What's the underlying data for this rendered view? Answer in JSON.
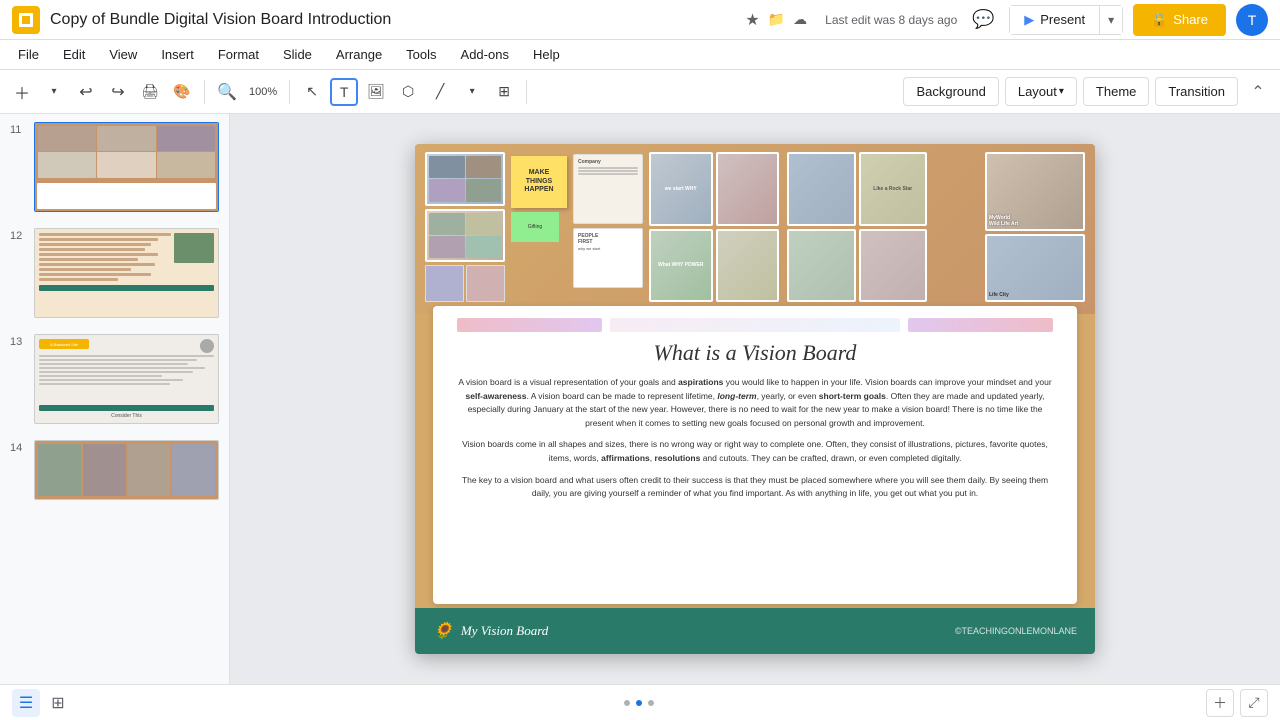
{
  "app": {
    "icon_color": "#F4B400",
    "title": "Copy of Bundle Digital Vision Board Introduction",
    "star_icon": "★",
    "folder_icon": "📁",
    "cloud_icon": "☁",
    "last_edit": "Last edit was 8 days ago"
  },
  "menu": {
    "items": [
      "File",
      "Edit",
      "View",
      "Insert",
      "Format",
      "Slide",
      "Arrange",
      "Tools",
      "Add-ons",
      "Help"
    ]
  },
  "toolbar": {
    "background_label": "Background",
    "layout_label": "Layout",
    "theme_label": "Theme",
    "transition_label": "Transition"
  },
  "header": {
    "present_label": "Present",
    "share_label": "Share",
    "avatar_letter": "T",
    "lock_icon": "🔒"
  },
  "slides": [
    {
      "number": "11",
      "type": "collage"
    },
    {
      "number": "12",
      "type": "text"
    },
    {
      "number": "13",
      "type": "text-badge"
    },
    {
      "number": "14",
      "type": "photos"
    }
  ],
  "main_slide": {
    "heading": "What is a Vision Board",
    "paragraph1": "A vision board is a visual representation of your goals and aspirations you would like to happen in your life. Vision boards can improve your mindset and your self-awareness. A vision board can be made to represent lifetime, long-term, yearly, or even short-term goals. Often they are made and updated yearly, especially during January at the start of the new year. However, there is no need to wait for the new year to make a vision board! There is no time like the present when it comes to setting new goals focused on personal growth and improvement.",
    "paragraph2": "Vision boards come in all shapes and sizes, there is no wrong way or right way to complete one. Often, they consist of illustrations, pictures, favorite quotes, items, words, affirmations, resolutions and cutouts. They can be crafted, drawn, or even completed digitally.",
    "paragraph3": "The key to a vision board and what users often credit to their success is that they must be placed somewhere where you will see them daily. By seeing them daily, you are giving yourself a reminder of what you find important. As with anything in life, you get out what you put in.",
    "footer_text": "My Vision Board",
    "copyright": "©TEACHINGONLEMONLANE",
    "sticky_notes": [
      {
        "text": "MAKE THINGS HAPPEN",
        "color": "#FFE066"
      },
      {
        "text": "PEOPLE FIRST",
        "color": "#d0e8ff"
      },
      {
        "text": "POWER",
        "color": "#f0d0e8"
      }
    ]
  },
  "bottom_bar": {
    "view_list_icon": "☰",
    "view_grid_icon": "⊞"
  }
}
